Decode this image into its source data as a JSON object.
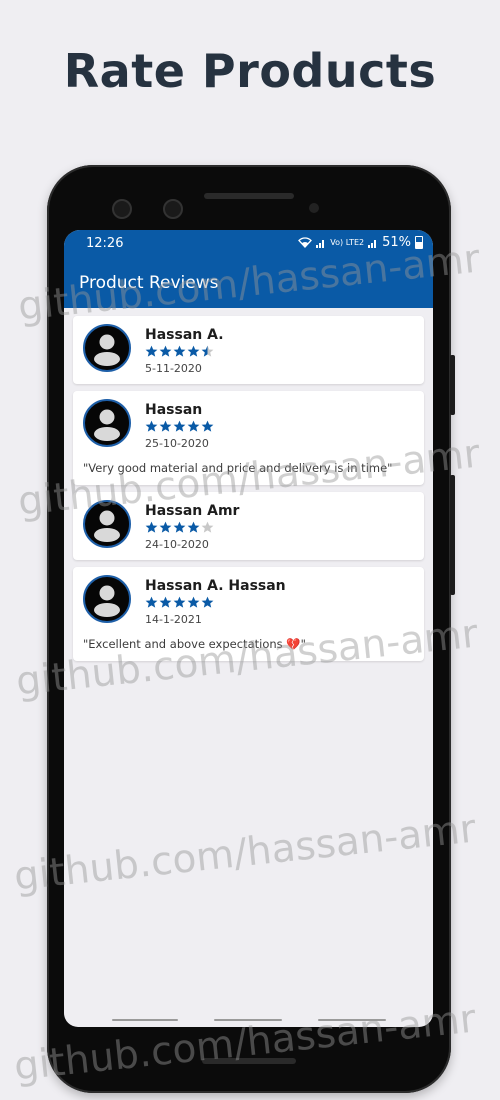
{
  "header": {
    "title": "Rate Products"
  },
  "status_bar": {
    "time": "12:26",
    "signal": "Vo) LTE2",
    "battery": "51%"
  },
  "app_bar": {
    "title": "Product Reviews"
  },
  "reviews": [
    {
      "name": "Hassan A.",
      "rating": 4.5,
      "date": "5-11-2020",
      "comment": ""
    },
    {
      "name": "Hassan",
      "rating": 5,
      "date": "25-10-2020",
      "comment": "\"Very good material and price and delivery is in time\""
    },
    {
      "name": "Hassan Amr",
      "rating": 4,
      "date": "24-10-2020",
      "comment": ""
    },
    {
      "name": "Hassan A. Hassan",
      "rating": 5,
      "date": "14-1-2021",
      "comment": "\"Excellent and above expectations 💔\""
    }
  ],
  "watermark": {
    "text": "github.com/hassan-amr"
  },
  "colors": {
    "primary": "#0a5aa6",
    "star": "#0a5aa6",
    "star_empty": "#c8c8c8",
    "title": "#263240"
  }
}
